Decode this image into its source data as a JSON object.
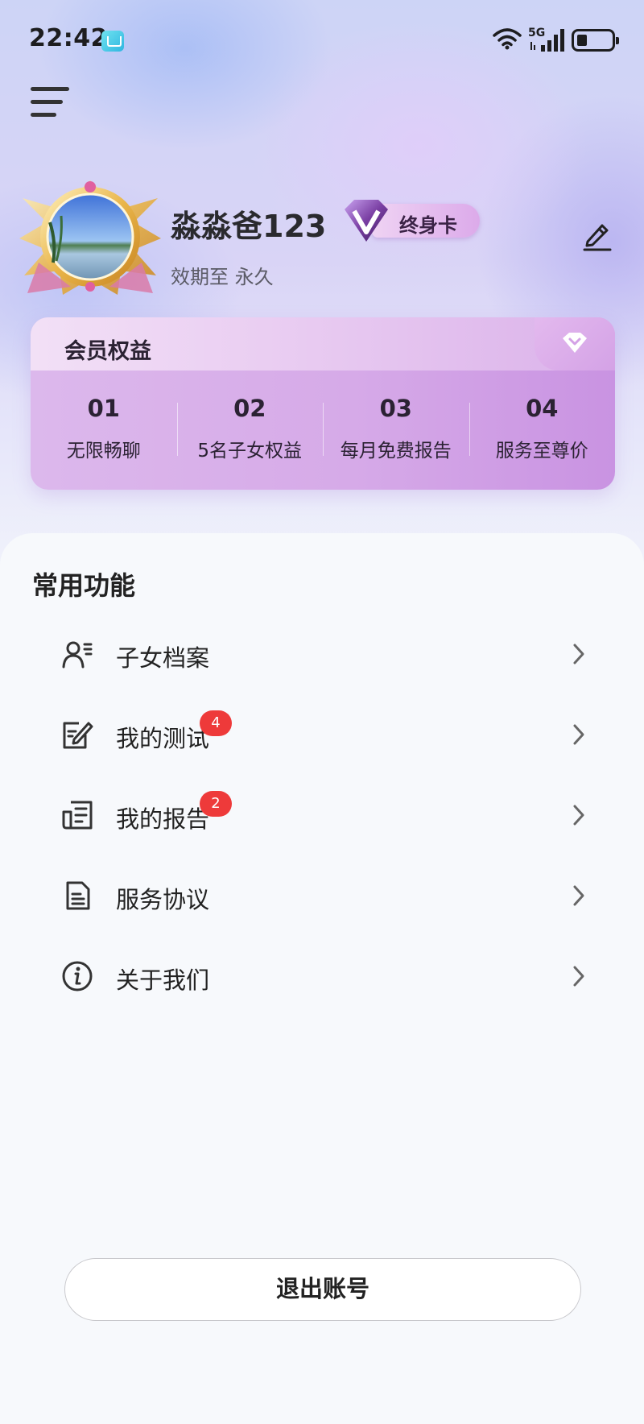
{
  "status_bar": {
    "time": "22:42",
    "network": "5G"
  },
  "profile": {
    "username": "淼淼爸123",
    "vip_label": "终身卡",
    "validity": "效期至 永久"
  },
  "membership": {
    "title": "会员权益",
    "benefits": [
      {
        "num": "01",
        "label": "无限畅聊"
      },
      {
        "num": "02",
        "label": "5名子女权益"
      },
      {
        "num": "03",
        "label": "每月免费报告"
      },
      {
        "num": "04",
        "label": "服务至尊价"
      }
    ]
  },
  "functions": {
    "title": "常用功能",
    "items": [
      {
        "label": "子女档案",
        "icon": "child-profile-icon",
        "badge": ""
      },
      {
        "label": "我的测试",
        "icon": "test-edit-icon",
        "badge": "4"
      },
      {
        "label": "我的报告",
        "icon": "report-icon",
        "badge": "2"
      },
      {
        "label": "服务协议",
        "icon": "document-icon",
        "badge": ""
      },
      {
        "label": "关于我们",
        "icon": "info-icon",
        "badge": ""
      }
    ]
  },
  "logout_label": "退出账号",
  "colors": {
    "badge": "#ee3a3a",
    "card": "#d6aae8",
    "accent": "#7a3fa3"
  }
}
